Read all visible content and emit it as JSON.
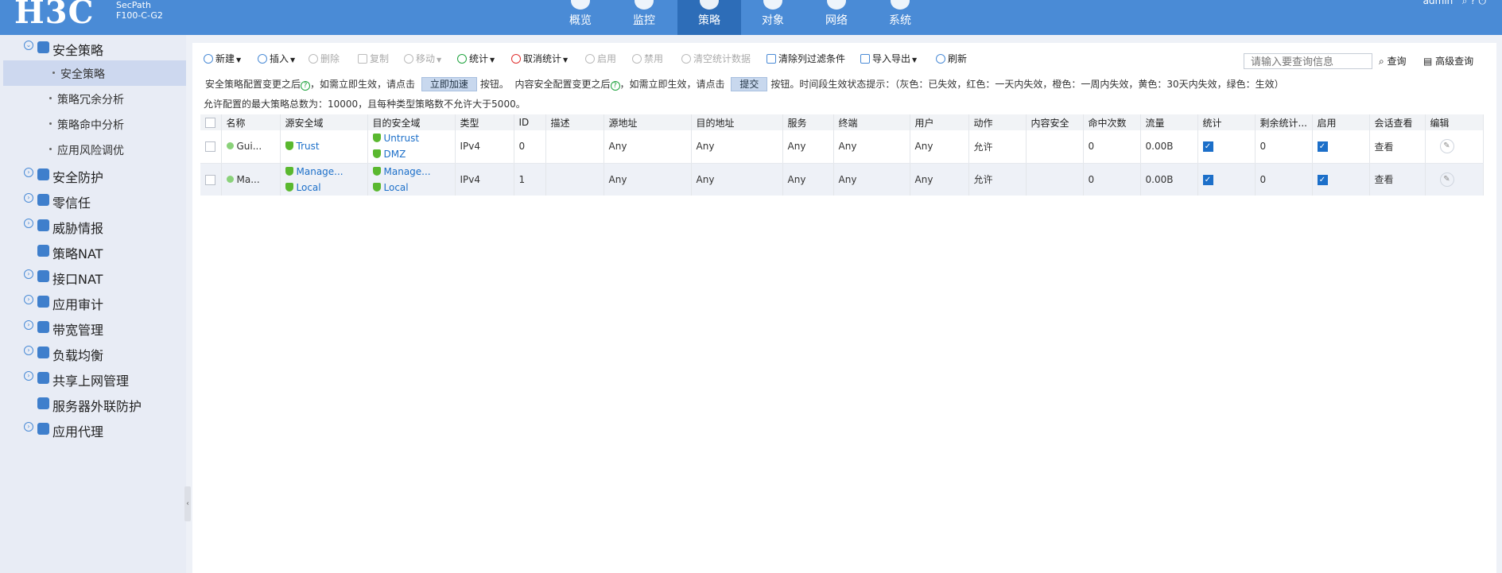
{
  "header": {
    "logo": "H3C",
    "model_line1": "SecPath",
    "model_line2": "F100-C-G2",
    "nav": [
      {
        "label": "概览"
      },
      {
        "label": "监控"
      },
      {
        "label": "策略"
      },
      {
        "label": "对象"
      },
      {
        "label": "网络"
      },
      {
        "label": "系统"
      }
    ],
    "user": "admin"
  },
  "sidebar": {
    "menu": [
      {
        "label": "安全策略",
        "icon": "shield-icon"
      },
      {
        "label": "安全防护",
        "icon": "shield-icon"
      },
      {
        "label": "零信任",
        "icon": "shield-icon"
      },
      {
        "label": "威胁情报",
        "icon": "eye-icon"
      },
      {
        "label": "策略NAT",
        "icon": "network-icon"
      },
      {
        "label": "接口NAT",
        "icon": "network-icon"
      },
      {
        "label": "应用审计",
        "icon": "grid-icon"
      },
      {
        "label": "带宽管理",
        "icon": "tree-icon"
      },
      {
        "label": "负载均衡",
        "icon": "balance-icon"
      },
      {
        "label": "共享上网管理",
        "icon": "share-icon"
      },
      {
        "label": "服务器外联防护",
        "icon": "server-shield-icon"
      },
      {
        "label": "应用代理",
        "icon": "compass-icon"
      }
    ],
    "sub": [
      {
        "label": "安全策略"
      },
      {
        "label": "策略冗余分析"
      },
      {
        "label": "策略命中分析"
      },
      {
        "label": "应用风险调优"
      }
    ]
  },
  "toolbar": {
    "new": "新建",
    "insert": "插入",
    "delete": "删除",
    "copy": "复制",
    "move": "移动",
    "stats": "统计",
    "cancel_stats": "取消统计",
    "enable": "启用",
    "disable": "禁用",
    "clear_stats": "清空统计数据",
    "clear_filter": "清除列过滤条件",
    "import_export": "导入导出",
    "refresh": "刷新",
    "search_placeholder": "请输入要查询信息",
    "query": "查询",
    "advanced_query": "高级查询"
  },
  "notice": {
    "part1": "安全策略配置变更之后",
    "part2": "，如需立即生效，请点击",
    "btn_accelerate": "立即加速",
    "part3": "按钮。",
    "part4": "内容安全配置变更之后",
    "part5": "，如需立即生效，请点击",
    "btn_submit": "提交",
    "part6": "按钮。时间段生效状态提示：（灰色：已失效，红色：一天内失效，橙色：一周内失效，黄色：30天内失效，绿色：生效）",
    "limit": "允许配置的最大策略总数为：10000，且每种类型策略数不允许大于5000。"
  },
  "table": {
    "columns": [
      "名称",
      "源安全域",
      "目的安全域",
      "类型",
      "ID",
      "描述",
      "源地址",
      "目的地址",
      "服务",
      "终端",
      "用户",
      "动作",
      "内容安全",
      "命中次数",
      "流量",
      "统计",
      "剩余统计...",
      "启用",
      "会话查看",
      "编辑"
    ],
    "rows": [
      {
        "name": "Gui...",
        "src_zones": [
          "Trust"
        ],
        "dst_zones": [
          "Untrust",
          "DMZ"
        ],
        "type": "IPv4",
        "id": "0",
        "desc": "",
        "src_addr": "Any",
        "dst_addr": "Any",
        "service": "Any",
        "terminal": "Any",
        "user": "Any",
        "action": "允许",
        "content_security": "",
        "hits": "0",
        "traffic": "0.00B",
        "stats_enabled": true,
        "remaining": "0",
        "enabled": true,
        "session_view": "查看"
      },
      {
        "name": "Ma...",
        "src_zones": [
          "Manage...",
          "Local"
        ],
        "dst_zones": [
          "Manage...",
          "Local"
        ],
        "type": "IPv4",
        "id": "1",
        "desc": "",
        "src_addr": "Any",
        "dst_addr": "Any",
        "service": "Any",
        "terminal": "Any",
        "user": "Any",
        "action": "允许",
        "content_security": "",
        "hits": "0",
        "traffic": "0.00B",
        "stats_enabled": true,
        "remaining": "0",
        "enabled": true,
        "session_view": "查看"
      }
    ]
  },
  "colors": {
    "header_bg": "#4a8bd6",
    "nav_active": "#2d6db8",
    "link": "#1c6fc9",
    "allow": "#1fa33e"
  }
}
